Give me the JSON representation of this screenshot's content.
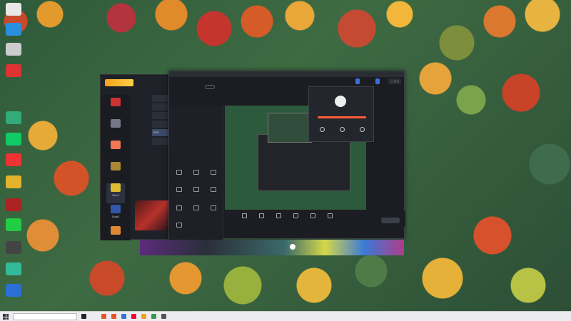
{
  "desktop": {
    "icons": [
      "",
      "",
      "",
      "",
      "",
      "",
      "",
      "",
      "",
      "",
      "",
      "",
      "",
      "",
      "",
      "",
      ""
    ],
    "notes": [
      "",
      ""
    ]
  },
  "game_center": {
    "title": "",
    "sidebar": [
      "",
      "",
      "",
      "",
      "Wer3",
      "Dota2",
      ""
    ],
    "list": [
      "",
      "",
      "",
      "",
      "ZYIZ",
      ""
    ],
    "banner": "",
    "footer": "Dota2"
  },
  "recorder": {
    "title_bar": "",
    "brand": "",
    "version_badge": "",
    "top_buttons": [
      "",
      ""
    ],
    "tabs": [
      "",
      "",
      ""
    ],
    "section_label": "",
    "tools_row1": [
      "",
      "",
      ""
    ],
    "tools_row2": [
      "",
      "",
      ""
    ],
    "tools_row3": [
      "",
      "",
      ""
    ],
    "tools_row4": [
      "",
      "",
      ""
    ],
    "controls": [
      "",
      "",
      "",
      "",
      "",
      ""
    ],
    "start_button": ""
  },
  "popup": {
    "name": "",
    "icons": [
      "",
      "",
      ""
    ]
  },
  "music": {
    "song": ""
  },
  "taskbar": {
    "search_placeholder": "",
    "clock_time": "",
    "clock_date": ""
  }
}
